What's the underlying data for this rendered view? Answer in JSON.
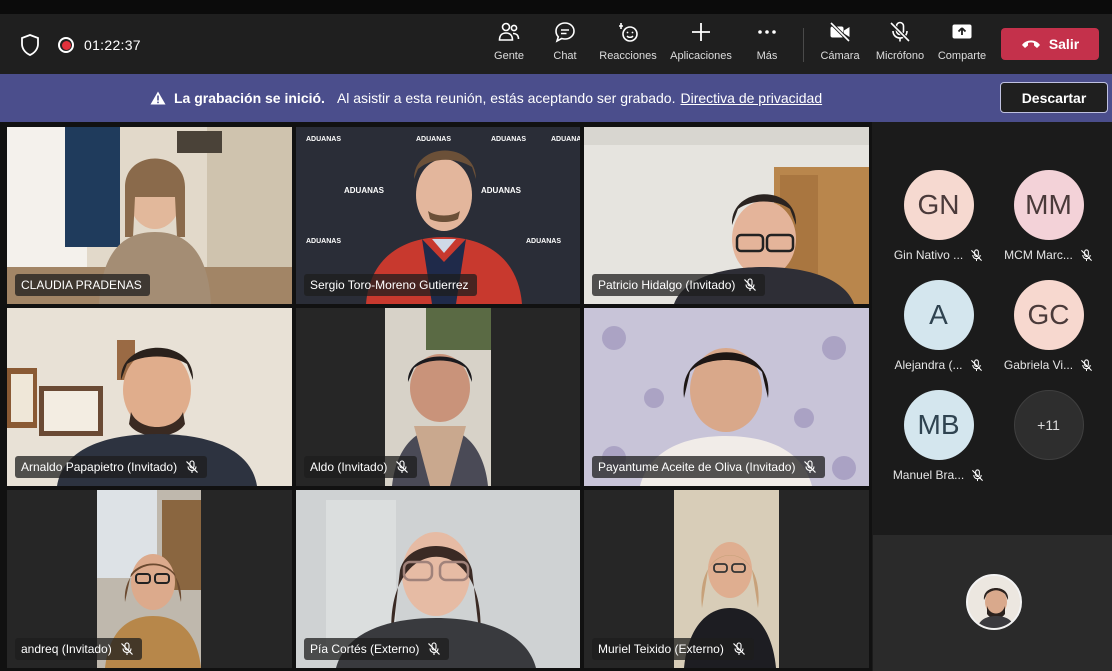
{
  "toolbar": {
    "timer": "01:22:37",
    "buttons": [
      {
        "label": "Gente",
        "icon": "people-icon"
      },
      {
        "label": "Chat",
        "icon": "chat-icon"
      },
      {
        "label": "Reacciones",
        "icon": "reactions-icon"
      },
      {
        "label": "Aplicaciones",
        "icon": "plus-icon"
      },
      {
        "label": "Más",
        "icon": "more-icon"
      },
      {
        "label": "Cámara",
        "icon": "camera-off-icon"
      },
      {
        "label": "Micrófono",
        "icon": "mic-off-icon"
      },
      {
        "label": "Comparte",
        "icon": "share-icon"
      }
    ],
    "leave_label": "Salir"
  },
  "banner": {
    "bold": "La grabación se inició.",
    "text": "Al asistir a esta reunión, estás aceptando ser grabado.",
    "link": "Directiva de privacidad",
    "dismiss": "Descartar"
  },
  "tiles": [
    {
      "name": "CLAUDIA PRADENAS",
      "muted": false
    },
    {
      "name": "Sergio Toro-Moreno Gutierrez",
      "muted": false
    },
    {
      "name": "Patricio Hidalgo (Invitado)",
      "muted": true
    },
    {
      "name": "Arnaldo Papapietro (Invitado)",
      "muted": true
    },
    {
      "name": "Aldo (Invitado)",
      "muted": true
    },
    {
      "name": "Payantume Aceite de Oliva (Invitado)",
      "muted": true
    },
    {
      "name": "andreq (Invitado)",
      "muted": true
    },
    {
      "name": "Pía Cortés (Externo)",
      "muted": true
    },
    {
      "name": "Muriel Teixido (Externo)",
      "muted": true
    }
  ],
  "tile_backdrop_text": "ADUANAS",
  "participants": [
    {
      "initials": "GN",
      "name": "Gin Nativo ...",
      "color": "#f6d9d0"
    },
    {
      "initials": "MM",
      "name": "MCM Marc...",
      "color": "#f3d2d8"
    },
    {
      "initials": "A",
      "name": "Alejandra (...",
      "color": "#d4e6ee"
    },
    {
      "initials": "GC",
      "name": "Gabriela Vi...",
      "color": "#f7d8cf"
    },
    {
      "initials": "MB",
      "name": "Manuel Bra...",
      "color": "#d4e6ee"
    }
  ],
  "overflow_count": "+11",
  "colors": {
    "accent": "#4b4e8c",
    "leave": "#c4314b",
    "record": "#e0313c"
  }
}
